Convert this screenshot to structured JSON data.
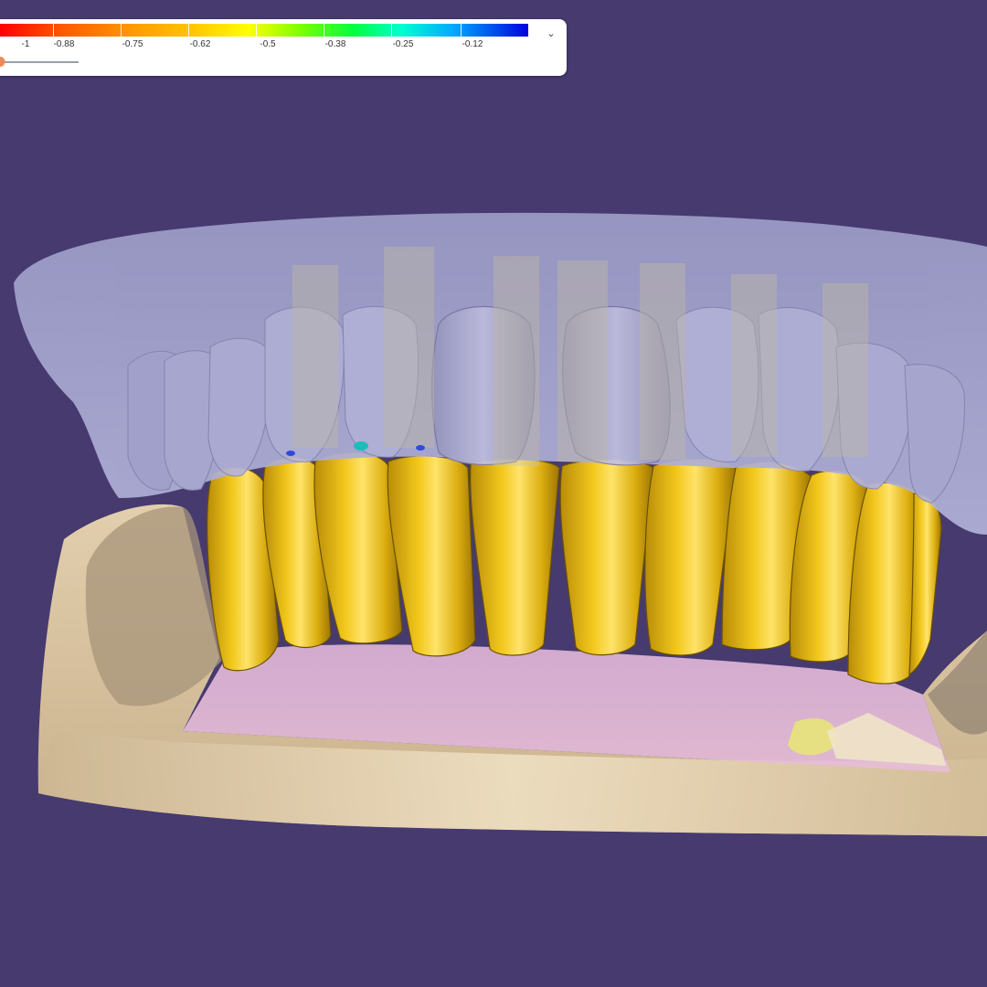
{
  "colors": {
    "background": "#463a6f",
    "crown": "#e0b512",
    "upper_scan": "#aaaad2",
    "model_base": "#d7c2a0",
    "gingiva": "#dfb4d0"
  },
  "legend": {
    "ticks": [
      "-1",
      "-0.88",
      "-0.75",
      "-0.62",
      "-0.5",
      "-0.38",
      "-0.25",
      "-0.12"
    ],
    "gradient": [
      "#ff0000",
      "#ff9a00",
      "#ffff00",
      "#00ff40",
      "#00ffd0",
      "#00a8ff",
      "#0000e0"
    ],
    "toggle_icon": "chevron-down-icon",
    "toggle_glyph": "⌄",
    "slider_value": 0.0
  }
}
